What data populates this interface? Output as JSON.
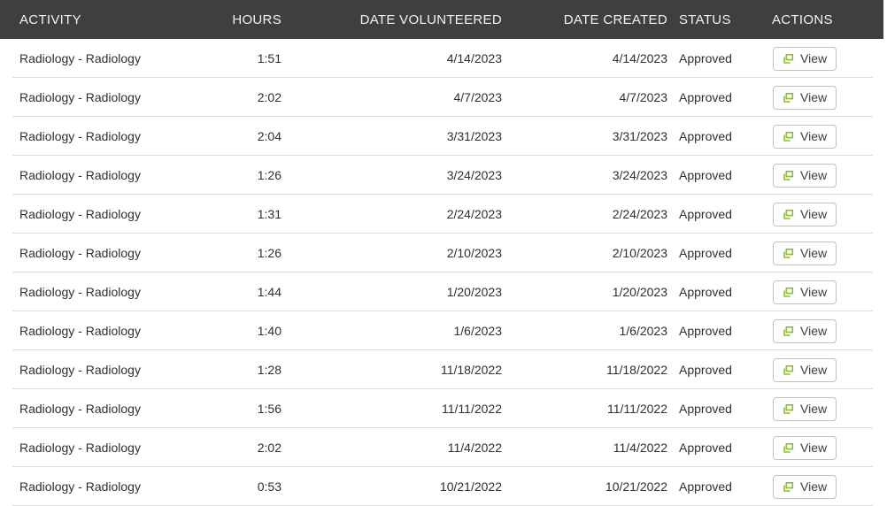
{
  "table": {
    "columns": [
      {
        "label": "ACTIVITY"
      },
      {
        "label": "HOURS"
      },
      {
        "label": "DATE VOLUNTEERED"
      },
      {
        "label": "DATE CREATED"
      },
      {
        "label": "STATUS"
      },
      {
        "label": "ACTIONS"
      }
    ],
    "view_label": "View",
    "rows": [
      {
        "activity": "Radiology - Radiology",
        "hours": "1:51",
        "date_volunteered": "4/14/2023",
        "date_created": "4/14/2023",
        "status": "Approved"
      },
      {
        "activity": "Radiology - Radiology",
        "hours": "2:02",
        "date_volunteered": "4/7/2023",
        "date_created": "4/7/2023",
        "status": "Approved"
      },
      {
        "activity": "Radiology - Radiology",
        "hours": "2:04",
        "date_volunteered": "3/31/2023",
        "date_created": "3/31/2023",
        "status": "Approved"
      },
      {
        "activity": "Radiology - Radiology",
        "hours": "1:26",
        "date_volunteered": "3/24/2023",
        "date_created": "3/24/2023",
        "status": "Approved"
      },
      {
        "activity": "Radiology - Radiology",
        "hours": "1:31",
        "date_volunteered": "2/24/2023",
        "date_created": "2/24/2023",
        "status": "Approved"
      },
      {
        "activity": "Radiology - Radiology",
        "hours": "1:26",
        "date_volunteered": "2/10/2023",
        "date_created": "2/10/2023",
        "status": "Approved"
      },
      {
        "activity": "Radiology - Radiology",
        "hours": "1:44",
        "date_volunteered": "1/20/2023",
        "date_created": "1/20/2023",
        "status": "Approved"
      },
      {
        "activity": "Radiology - Radiology",
        "hours": "1:40",
        "date_volunteered": "1/6/2023",
        "date_created": "1/6/2023",
        "status": "Approved"
      },
      {
        "activity": "Radiology - Radiology",
        "hours": "1:28",
        "date_volunteered": "11/18/2022",
        "date_created": "11/18/2022",
        "status": "Approved"
      },
      {
        "activity": "Radiology - Radiology",
        "hours": "1:56",
        "date_volunteered": "11/11/2022",
        "date_created": "11/11/2022",
        "status": "Approved"
      },
      {
        "activity": "Radiology - Radiology",
        "hours": "2:02",
        "date_volunteered": "11/4/2022",
        "date_created": "11/4/2022",
        "status": "Approved"
      },
      {
        "activity": "Radiology - Radiology",
        "hours": "0:53",
        "date_volunteered": "10/21/2022",
        "date_created": "10/21/2022",
        "status": "Approved"
      }
    ]
  },
  "colors": {
    "header_bg": "#3f3f3f",
    "header_text": "#f2f2f2",
    "row_text": "#2f2f2f",
    "divider": "#dddddd",
    "button_border": "#c3c3c3",
    "icon_green": "#8cbe2f"
  }
}
